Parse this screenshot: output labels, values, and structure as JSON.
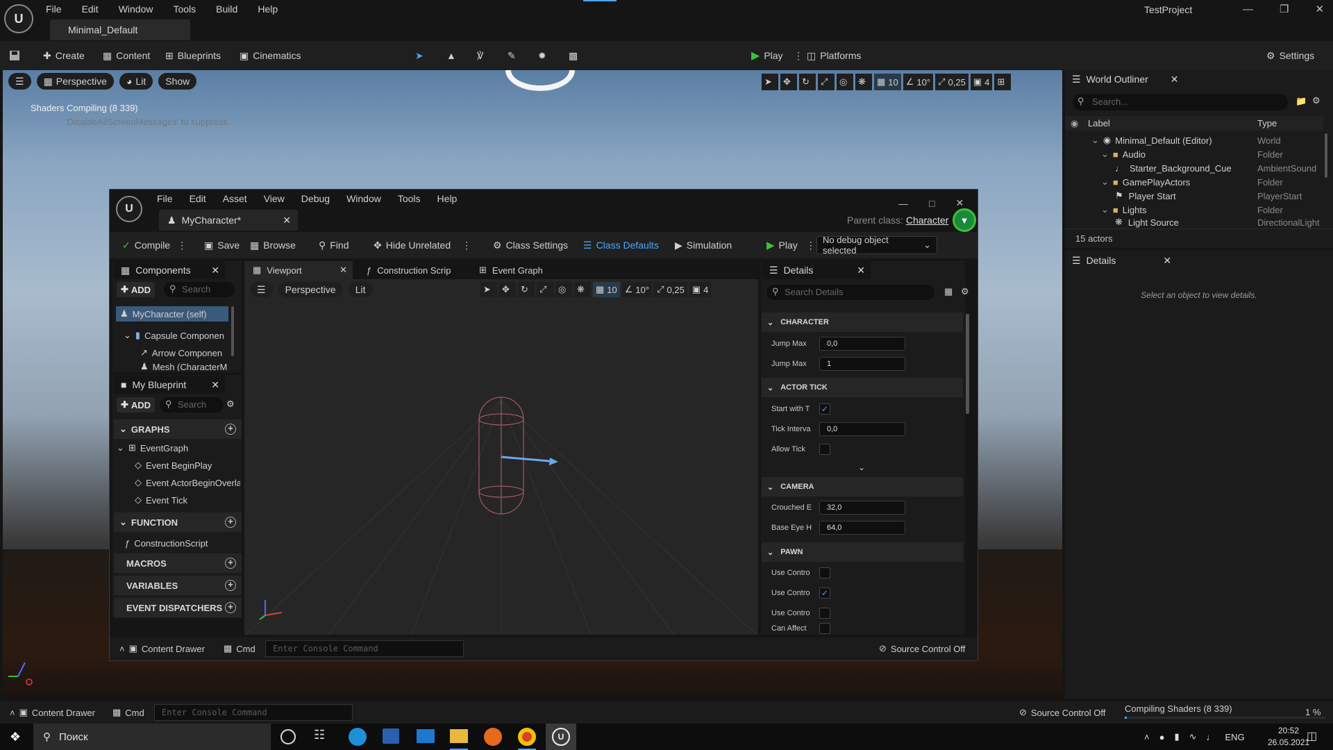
{
  "app": {
    "main_menu": [
      "File",
      "Edit",
      "Window",
      "Tools",
      "Build",
      "Help"
    ],
    "doc_tab": "Minimal_Default",
    "project_name": "TestProject",
    "toolbar": {
      "create": "Create",
      "content": "Content",
      "blueprints": "Blueprints",
      "cinematics": "Cinematics",
      "play": "Play",
      "platforms": "Platforms",
      "settings": "Settings"
    }
  },
  "level_viewport": {
    "perspective": "Perspective",
    "lit": "Lit",
    "show": "Show",
    "shader_message": "Shaders Compiling (8 339)",
    "shader_hint": "'DisableAllScreenMessages' to suppress",
    "grid_snap": "10",
    "rot_snap": "10°",
    "scale_snap": "0,25",
    "camera_speed": "4"
  },
  "world_outliner": {
    "title": "World Outliner",
    "search_placeholder": "Search...",
    "col_label": "Label",
    "col_type": "Type",
    "rows": [
      {
        "label": "Minimal_Default (Editor)",
        "type": "World"
      },
      {
        "label": "Audio",
        "type": "Folder"
      },
      {
        "label": "Starter_Background_Cue",
        "type": "AmbientSound"
      },
      {
        "label": "GamePlayActors",
        "type": "Folder"
      },
      {
        "label": "Player Start",
        "type": "PlayerStart"
      },
      {
        "label": "Lights",
        "type": "Folder"
      },
      {
        "label": "Light Source",
        "type": "DirectionalLight"
      }
    ],
    "actor_count": "15 actors"
  },
  "details_main": {
    "title": "Details",
    "empty_message": "Select an object to view details."
  },
  "blueprint_editor": {
    "menu": [
      "File",
      "Edit",
      "Asset",
      "View",
      "Debug",
      "Window",
      "Tools",
      "Help"
    ],
    "tab_name": "MyCharacter*",
    "parent_class_label": "Parent class:",
    "parent_class": "Character",
    "toolbar": {
      "compile": "Compile",
      "save": "Save",
      "browse": "Browse",
      "find": "Find",
      "hide_unrelated": "Hide Unrelated",
      "class_settings": "Class Settings",
      "class_defaults": "Class Defaults",
      "simulation": "Simulation",
      "play": "Play",
      "debug_object": "No debug object selected"
    },
    "components": {
      "title": "Components",
      "add": "ADD",
      "search_placeholder": "Search",
      "items": [
        "MyCharacter (self)",
        "Capsule Componen",
        "Arrow Componen",
        "Mesh (CharacterM"
      ]
    },
    "my_blueprint": {
      "title": "My Blueprint",
      "add": "ADD",
      "search_placeholder": "Search",
      "graphs": "GRAPHS",
      "event_graph": "EventGraph",
      "events": [
        "Event BeginPlay",
        "Event ActorBeginOverla",
        "Event Tick"
      ],
      "functions": "FUNCTION",
      "construction_script": "ConstructionScript",
      "macros": "MACROS",
      "variables": "VARIABLES",
      "event_dispatchers": "EVENT DISPATCHERS"
    },
    "viewport_tabs": [
      "Viewport",
      "Construction Scrip",
      "Event Graph"
    ],
    "viewport": {
      "perspective": "Perspective",
      "lit": "Lit",
      "grid_snap": "10",
      "rot_snap": "10°",
      "scale_snap": "0,25",
      "camera_speed": "4"
    },
    "details": {
      "title": "Details",
      "search_placeholder": "Search Details",
      "sections": {
        "character": "CHARACTER",
        "actor_tick": "ACTOR TICK",
        "camera": "CAMERA",
        "pawn": "PAWN"
      },
      "character_props": [
        {
          "label": "Jump Max",
          "value": "0,0"
        },
        {
          "label": "Jump Max",
          "value": "1"
        }
      ],
      "tick_props": {
        "start_label": "Start with T",
        "start_checked": true,
        "interval_label": "Tick Interva",
        "interval_value": "0,0",
        "allow_label": "Allow Tick",
        "allow_checked": false
      },
      "camera_props": [
        {
          "label": "Crouched E",
          "value": "32,0"
        },
        {
          "label": "Base Eye H",
          "value": "64,0"
        }
      ],
      "pawn_props": [
        {
          "label": "Use Contro",
          "checked": false
        },
        {
          "label": "Use Contro",
          "checked": true
        },
        {
          "label": "Use Contro",
          "checked": false
        },
        {
          "label": "Can Affect",
          "checked": false
        }
      ]
    },
    "bottom": {
      "content_drawer": "Content Drawer",
      "cmd": "Cmd",
      "console_placeholder": "Enter Console Command",
      "source_control": "Source Control Off"
    }
  },
  "status_bar": {
    "content_drawer": "Content Drawer",
    "cmd": "Cmd",
    "console_placeholder": "Enter Console Command",
    "source_control": "Source Control Off",
    "compiling": "Compiling Shaders (8 339)",
    "percent": "1 %"
  },
  "taskbar": {
    "search": "Поиск",
    "lang": "ENG",
    "time": "20:52",
    "date": "26.05.2021"
  },
  "colors": {
    "accent_blue": "#4aa8ff",
    "play_green": "#3fbf3f",
    "panel_bg": "#1b1b1b"
  }
}
